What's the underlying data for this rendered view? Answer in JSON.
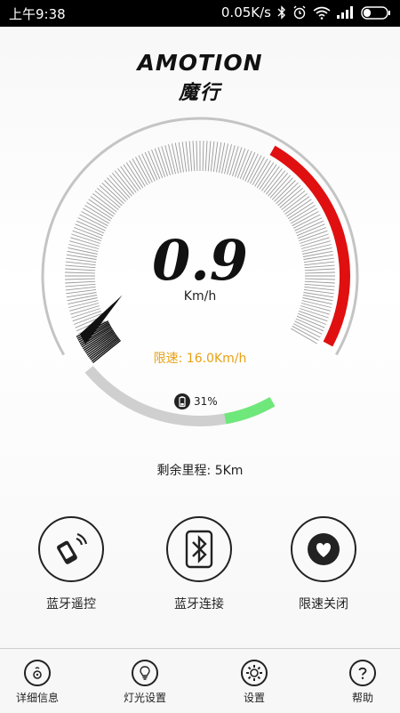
{
  "status_bar": {
    "time": "上午9:38",
    "net_speed": "0.05K/s",
    "icons": [
      "bluetooth-icon",
      "alarm-icon",
      "wifi-icon",
      "signal-icon",
      "battery-icon"
    ]
  },
  "logo": {
    "brand_en": "AMOTION",
    "brand_cn": "魔行"
  },
  "gauge": {
    "speed": "0.9",
    "unit": "Km/h",
    "speed_limit_label": "限速:",
    "speed_limit_value": "16.0Km/h",
    "battery_percent": "31%",
    "battery_fraction": 0.31,
    "speed_fraction": 0.03,
    "colors": {
      "danger": "#e01010",
      "battery": "#6ee87a",
      "limit": "#e8a114",
      "ticks": "#9a9a9a"
    }
  },
  "remaining_range": "剩余里程: 5Km",
  "actions": [
    {
      "label": "蓝牙遥控",
      "icon": "remote-control-icon"
    },
    {
      "label": "蓝牙连接",
      "icon": "bluetooth-icon"
    },
    {
      "label": "限速关闭",
      "icon": "heart-icon"
    }
  ],
  "nav": [
    {
      "label": "详细信息",
      "icon": "info-icon"
    },
    {
      "label": "灯光设置",
      "icon": "lightbulb-icon"
    },
    {
      "label": "设置",
      "icon": "gear-icon"
    },
    {
      "label": "帮助",
      "icon": "help-icon"
    }
  ]
}
